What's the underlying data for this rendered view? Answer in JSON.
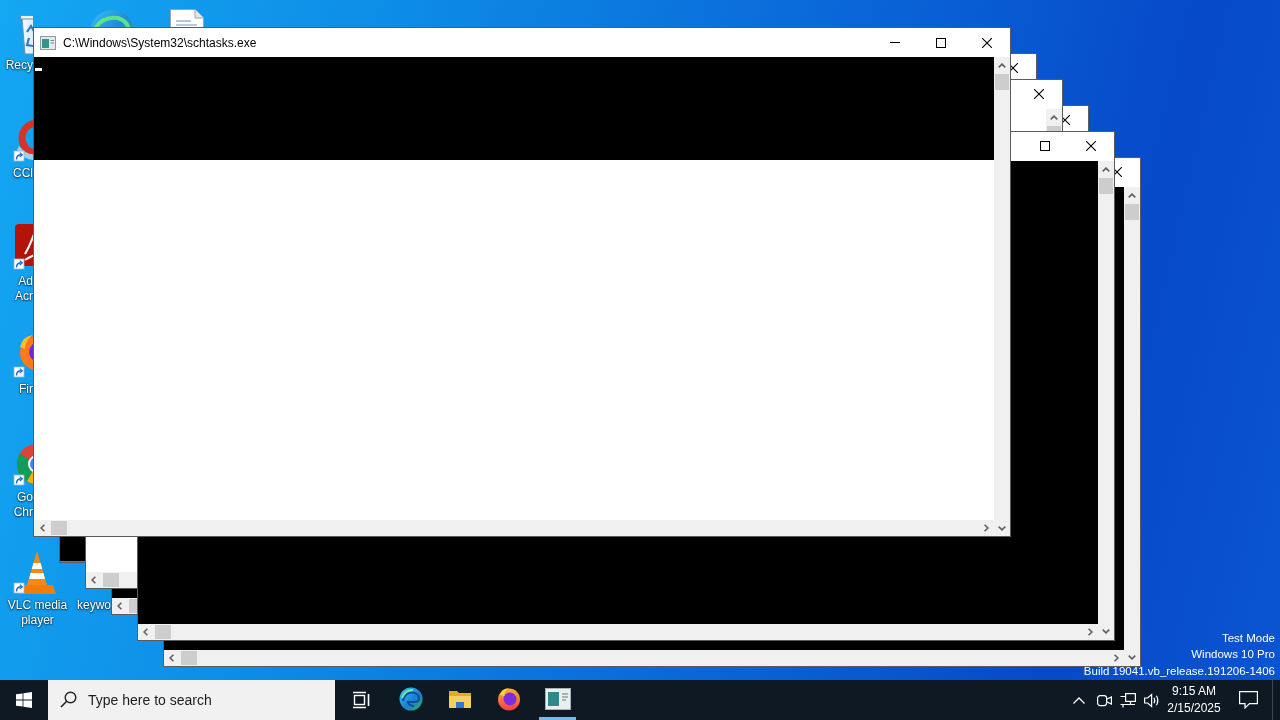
{
  "desktop": {
    "icons": [
      {
        "label": "Recy"
      },
      {
        "label": "CCl"
      },
      {
        "label": "Ad Acr"
      },
      {
        "label": "Fir"
      },
      {
        "label": "Go Chr"
      },
      {
        "label": "VLC media player"
      },
      {
        "label": "keywo"
      }
    ],
    "system_info": [
      "Test Mode",
      "Windows 10 Pro",
      "Build 19041.vb_release.191206-1406"
    ]
  },
  "console_windows": [
    {
      "title": "C:\\Windows\\System32\\schtasks.exe",
      "kind": "partial"
    },
    {
      "kind": "bare"
    },
    {
      "kind": "blank"
    },
    {
      "kind": "console"
    },
    {
      "kind": "console"
    },
    {
      "kind": "console"
    }
  ],
  "taskbar": {
    "search": {
      "placeholder": "Type here to search"
    },
    "apps": [
      {
        "running": false
      },
      {
        "running": false
      },
      {
        "running": false
      },
      {
        "running": true
      }
    ],
    "clock": {
      "time": "9:15 AM",
      "date": "2/15/2025"
    }
  }
}
